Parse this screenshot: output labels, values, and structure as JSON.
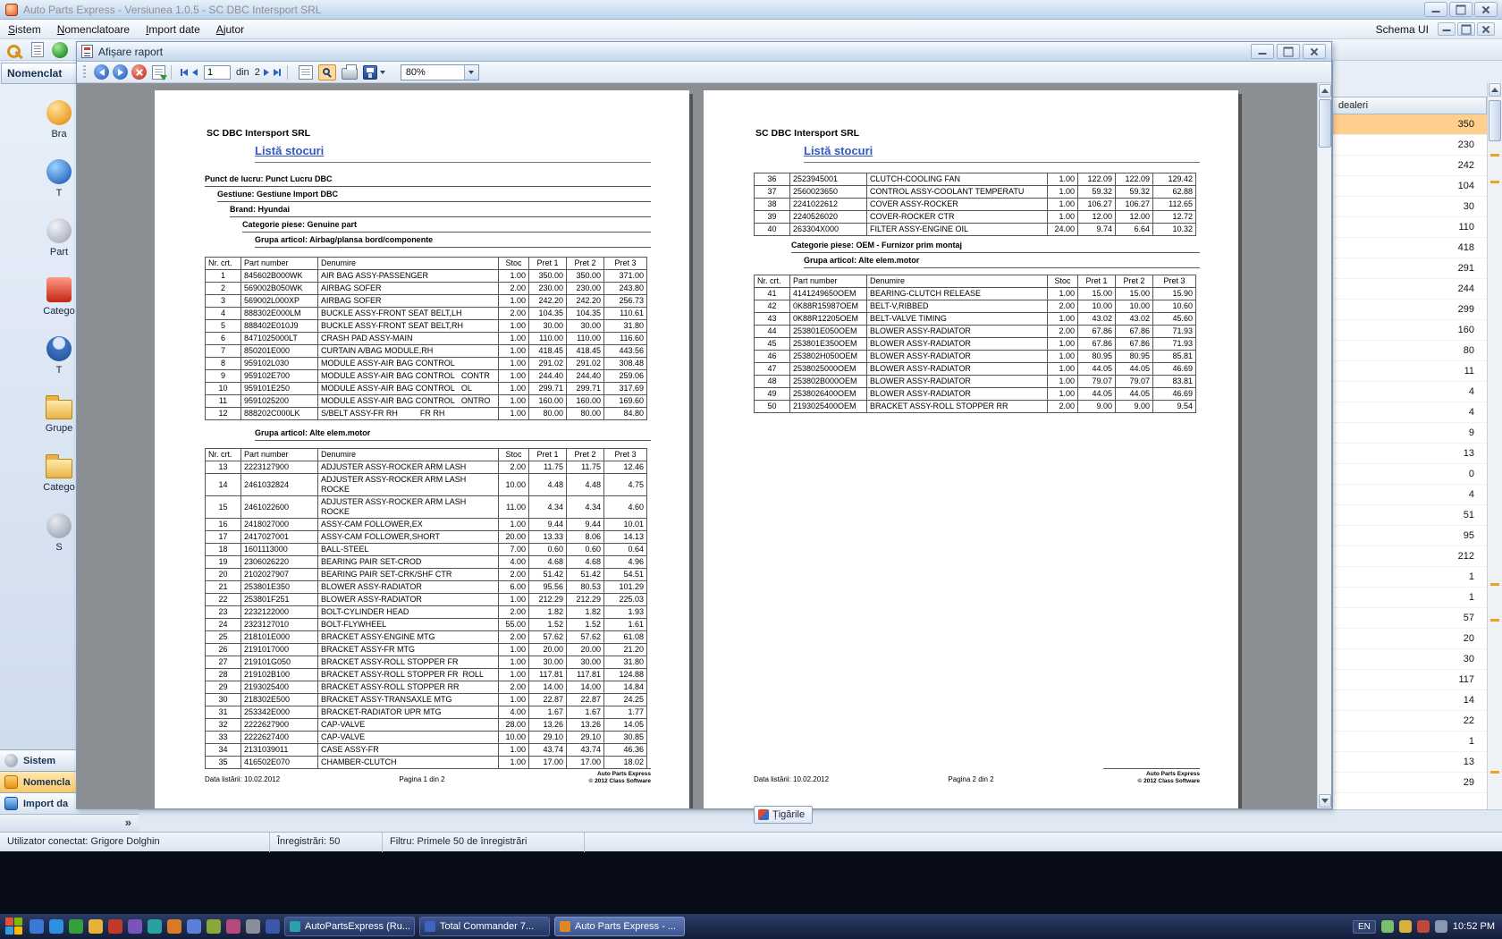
{
  "window": {
    "title": "Auto Parts Express - Versiunea 1.0.5 - SC DBC Intersport SRL",
    "menu": [
      "Sistem",
      "Nomenclatoare",
      "Import date",
      "Ajutor"
    ],
    "schema_ui": "Schema UI"
  },
  "sidebar": {
    "header": "Nomenclat",
    "items": [
      {
        "icon": "brand-icon",
        "label": "Bra"
      },
      {
        "icon": "globe-icon",
        "label": "T"
      },
      {
        "icon": "partners-icon",
        "label": "Part"
      },
      {
        "icon": "categories-icon",
        "label": "Catego"
      },
      {
        "icon": "person-icon",
        "label": "T"
      },
      {
        "icon": "groups-folder-icon",
        "label": "Grupe"
      },
      {
        "icon": "categories-folder-icon",
        "label": "Catego"
      },
      {
        "icon": "settings-icon",
        "label": "S"
      }
    ],
    "bars": [
      "Sistem",
      "Nomencla",
      "Import da"
    ],
    "chevron": "»"
  },
  "report_window": {
    "title": "Afișare raport",
    "toolbar": {
      "page_current": "1",
      "of_label": "din",
      "page_total": "2",
      "zoom": "80%"
    }
  },
  "report": {
    "company": "SC DBC Intersport SRL",
    "title": "Listă stocuri",
    "columns": [
      "Nr. crt.",
      "Part number",
      "Denumire",
      "Stoc",
      "Pret 1",
      "Pret 2",
      "Pret 3"
    ],
    "page1": {
      "punct": "Punct de lucru: Punct Lucru DBC",
      "gestiune": "Gestiune: Gestiune Import DBC",
      "brand": "Brand: Hyundai",
      "categorie": "Categorie piese: Genuine part",
      "grupa1": "Grupa articol: Airbag/plansa bord/componente",
      "grupa2": "Grupa articol: Alte elem.motor",
      "page_label": "Pagina 1 din 2"
    },
    "page2": {
      "categorie": "Categorie piese: OEM - Furnizor prim montaj",
      "grupa": "Grupa articol: Alte elem.motor",
      "page_label": "Pagina 2 din 2"
    },
    "footer": {
      "date": "Data listării: 10.02.2012",
      "brand_line1": "Auto Parts Express",
      "brand_line2": "© 2012 Class Software"
    },
    "table1": [
      [
        "1",
        "845602B000WK",
        "AIR BAG ASSY-PASSENGER",
        "1.00",
        "350.00",
        "350.00",
        "371.00"
      ],
      [
        "2",
        "569002B050WK",
        "AIRBAG SOFER",
        "2.00",
        "230.00",
        "230.00",
        "243.80"
      ],
      [
        "3",
        "569002L000XP",
        "AIRBAG SOFER",
        "1.00",
        "242.20",
        "242.20",
        "256.73"
      ],
      [
        "4",
        "888302E000LM",
        "BUCKLE ASSY-FRONT SEAT BELT,LH",
        "2.00",
        "104.35",
        "104.35",
        "110.61"
      ],
      [
        "5",
        "888402E010J9",
        "BUCKLE ASSY-FRONT SEAT BELT,RH",
        "1.00",
        "30.00",
        "30.00",
        "31.80"
      ],
      [
        "6",
        "8471025000LT",
        "CRASH PAD ASSY-MAIN",
        "1.00",
        "110.00",
        "110.00",
        "116.60"
      ],
      [
        "7",
        "850201E000",
        "CURTAIN A/BAG MODULE,RH",
        "1.00",
        "418.45",
        "418.45",
        "443.56"
      ],
      [
        "8",
        "959102L030",
        "MODULE ASSY-AIR BAG CONTROL",
        "1.00",
        "291.02",
        "291.02",
        "308.48"
      ],
      [
        "9",
        "959102E700",
        "MODULE ASSY-AIR BAG CONTROL   CONTR",
        "1.00",
        "244.40",
        "244.40",
        "259.06"
      ],
      [
        "10",
        "959101E250",
        "MODULE ASSY-AIR BAG CONTROL   OL",
        "1.00",
        "299.71",
        "299.71",
        "317.69"
      ],
      [
        "11",
        "9591025200",
        "MODULE ASSY-AIR BAG CONTROL   ONTRO",
        "1.00",
        "160.00",
        "160.00",
        "169.60"
      ],
      [
        "12",
        "888202C000LK",
        "S/BELT ASSY-FR RH          FR RH",
        "1.00",
        "80.00",
        "80.00",
        "84.80"
      ]
    ],
    "table2": [
      [
        "13",
        "2223127900",
        "ADJUSTER ASSY-ROCKER ARM LASH",
        "2.00",
        "11.75",
        "11.75",
        "12.46"
      ],
      [
        "14",
        "2461032824",
        "ADJUSTER ASSY-ROCKER ARM LASH\nROCKE",
        "10.00",
        "4.48",
        "4.48",
        "4.75"
      ],
      [
        "15",
        "2461022600",
        "ADJUSTER ASSY-ROCKER ARM LASH\nROCKE",
        "11.00",
        "4.34",
        "4.34",
        "4.60"
      ],
      [
        "16",
        "2418027000",
        "ASSY-CAM FOLLOWER,EX",
        "1.00",
        "9.44",
        "9.44",
        "10.01"
      ],
      [
        "17",
        "2417027001",
        "ASSY-CAM FOLLOWER,SHORT",
        "20.00",
        "13.33",
        "8.06",
        "14.13"
      ],
      [
        "18",
        "1601113000",
        "BALL-STEEL",
        "7.00",
        "0.60",
        "0.60",
        "0.64"
      ],
      [
        "19",
        "2306026220",
        "BEARING PAIR SET-CROD",
        "4.00",
        "4.68",
        "4.68",
        "4.96"
      ],
      [
        "20",
        "2102027907",
        "BEARING PAIR SET-CRK/SHF CTR",
        "2.00",
        "51.42",
        "51.42",
        "54.51"
      ],
      [
        "21",
        "253801E350",
        "BLOWER ASSY-RADIATOR",
        "6.00",
        "95.56",
        "80.53",
        "101.29"
      ],
      [
        "22",
        "253801F251",
        "BLOWER ASSY-RADIATOR",
        "1.00",
        "212.29",
        "212.29",
        "225.03"
      ],
      [
        "23",
        "2232122000",
        "BOLT-CYLINDER HEAD",
        "2.00",
        "1.82",
        "1.82",
        "1.93"
      ],
      [
        "24",
        "2323127010",
        "BOLT-FLYWHEEL",
        "55.00",
        "1.52",
        "1.52",
        "1.61"
      ],
      [
        "25",
        "218101E000",
        "BRACKET ASSY-ENGINE MTG",
        "2.00",
        "57.62",
        "57.62",
        "61.08"
      ],
      [
        "26",
        "2191017000",
        "BRACKET ASSY-FR MTG",
        "1.00",
        "20.00",
        "20.00",
        "21.20"
      ],
      [
        "27",
        "219101G050",
        "BRACKET ASSY-ROLL STOPPER FR",
        "1.00",
        "30.00",
        "30.00",
        "31.80"
      ],
      [
        "28",
        "219102B100",
        "BRACKET ASSY-ROLL STOPPER FR  ROLL",
        "1.00",
        "117.81",
        "117.81",
        "124.88"
      ],
      [
        "29",
        "2193025400",
        "BRACKET ASSY-ROLL STOPPER RR",
        "2.00",
        "14.00",
        "14.00",
        "14.84"
      ],
      [
        "30",
        "218302E500",
        "BRACKET ASSY-TRANSAXLE MTG",
        "1.00",
        "22.87",
        "22.87",
        "24.25"
      ],
      [
        "31",
        "253342E000",
        "BRACKET-RADIATOR UPR MTG",
        "4.00",
        "1.67",
        "1.67",
        "1.77"
      ],
      [
        "32",
        "2222627900",
        "CAP-VALVE",
        "28.00",
        "13.26",
        "13.26",
        "14.05"
      ],
      [
        "33",
        "2222627400",
        "CAP-VALVE",
        "10.00",
        "29.10",
        "29.10",
        "30.85"
      ],
      [
        "34",
        "2131039011",
        "CASE ASSY-FR",
        "1.00",
        "43.74",
        "43.74",
        "46.36"
      ],
      [
        "35",
        "416502E070",
        "CHAMBER-CLUTCH",
        "1.00",
        "17.00",
        "17.00",
        "18.02"
      ]
    ],
    "table3": [
      [
        "36",
        "2523945001",
        "CLUTCH-COOLING FAN",
        "1.00",
        "122.09",
        "122.09",
        "129.42"
      ],
      [
        "37",
        "2560023650",
        "CONTROL ASSY-COOLANT TEMPERATU",
        "1.00",
        "59.32",
        "59.32",
        "62.88"
      ],
      [
        "38",
        "2241022612",
        "COVER ASSY-ROCKER",
        "1.00",
        "106.27",
        "106.27",
        "112.65"
      ],
      [
        "39",
        "2240526020",
        "COVER-ROCKER CTR",
        "1.00",
        "12.00",
        "12.00",
        "12.72"
      ],
      [
        "40",
        "263304X000",
        "FILTER ASSY-ENGINE OIL",
        "24.00",
        "9.74",
        "6.64",
        "10.32"
      ]
    ],
    "table4": [
      [
        "41",
        "4141249650OEM",
        "BEARING-CLUTCH RELEASE",
        "1.00",
        "15.00",
        "15.00",
        "15.90"
      ],
      [
        "42",
        "0K88R15987OEM",
        "BELT-V,RIBBED",
        "2.00",
        "10.00",
        "10.00",
        "10.60"
      ],
      [
        "43",
        "0K88R12205OEM",
        "BELT-VALVE TIMING",
        "1.00",
        "43.02",
        "43.02",
        "45.60"
      ],
      [
        "44",
        "253801E050OEM",
        "BLOWER ASSY-RADIATOR",
        "2.00",
        "67.86",
        "67.86",
        "71.93"
      ],
      [
        "45",
        "253801E350OEM",
        "BLOWER ASSY-RADIATOR",
        "1.00",
        "67.86",
        "67.86",
        "71.93"
      ],
      [
        "46",
        "253802H050OEM",
        "BLOWER ASSY-RADIATOR",
        "1.00",
        "80.95",
        "80.95",
        "85.81"
      ],
      [
        "47",
        "2538025000OEM",
        "BLOWER ASSY-RADIATOR",
        "1.00",
        "44.05",
        "44.05",
        "46.69"
      ],
      [
        "48",
        "253802B000OEM",
        "BLOWER ASSY-RADIATOR",
        "1.00",
        "79.07",
        "79.07",
        "83.81"
      ],
      [
        "49",
        "2538026400OEM",
        "BLOWER ASSY-RADIATOR",
        "1.00",
        "44.05",
        "44.05",
        "46.69"
      ],
      [
        "50",
        "2193025400OEM",
        "BRACKET ASSY-ROLL STOPPER RR",
        "2.00",
        "9.00",
        "9.00",
        "9.54"
      ]
    ]
  },
  "grid": {
    "header": "dealeri",
    "values": [
      "350",
      "230",
      "242",
      "104",
      "30",
      "110",
      "418",
      "291",
      "244",
      "299",
      "160",
      "80",
      "11",
      "4",
      "4",
      "9",
      "13",
      "0",
      "4",
      "51",
      "95",
      "212",
      "1",
      "1",
      "57",
      "20",
      "30",
      "117",
      "14",
      "22",
      "1",
      "13",
      "29"
    ]
  },
  "floating": {
    "label": "Țigările"
  },
  "statusbar": {
    "user": "Utilizator conectat: Grigore Dolghin",
    "records": "Înregistrări: 50",
    "filter": "Filtru: Primele 50 de înregistrări"
  },
  "taskbar": {
    "buttons": [
      {
        "label": "AutoPartsExpress (Ru..."
      },
      {
        "label": "Total Commander 7..."
      },
      {
        "label": "Auto Parts Express - ..."
      }
    ],
    "tray": {
      "lang": "EN",
      "time": "10:52 PM"
    }
  }
}
